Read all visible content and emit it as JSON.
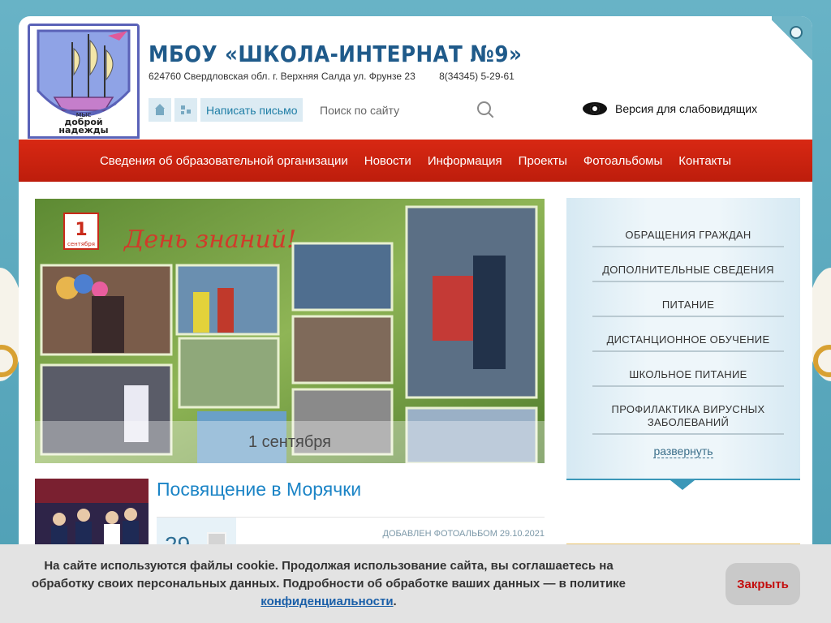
{
  "header": {
    "title": "МБОУ «ШКОЛА-ИНТЕРНАТ №9»",
    "address": "624760 Свердловская обл. г. Верхняя Салда ул. Фрунзе 23",
    "phone": "8(34345) 5-29-61",
    "logo_text_top": "мыс",
    "logo_text_mid": "доброй",
    "logo_text_bottom": "надежды"
  },
  "tools": {
    "home_icon": "home-icon",
    "sitemap_icon": "sitemap-icon",
    "write_label": "Написать письмо"
  },
  "search": {
    "placeholder": "Поиск по сайту",
    "icon": "search-icon"
  },
  "vision": {
    "label": "Версия для слабовидящих",
    "icon": "eye-icon"
  },
  "nav": {
    "items": [
      {
        "label": "Сведения об образовательной организации"
      },
      {
        "label": "Новости"
      },
      {
        "label": "Информация"
      },
      {
        "label": "Проекты"
      },
      {
        "label": "Фотоальбомы"
      },
      {
        "label": "Контакты"
      }
    ]
  },
  "slider": {
    "caption": "1 сентября",
    "banner_text": "День знаний!",
    "calendar_day": "1",
    "calendar_month": "сентября"
  },
  "news": {
    "title": "Посвящение в Морячки",
    "day": "29",
    "meta": "ДОБАВЛЕН ФОТОАЛЬБОМ 29.10.2021"
  },
  "panel": {
    "items": [
      {
        "label": "ОБРАЩЕНИЯ ГРАЖДАН"
      },
      {
        "label": "ДОПОЛНИТЕЛЬНЫЕ СВЕДЕНИЯ"
      },
      {
        "label": "ПИТАНИЕ"
      },
      {
        "label": "ДИСТАНЦИОННОЕ ОБУЧЕНИЕ"
      },
      {
        "label": "ШКОЛЬНОЕ ПИТАНИЕ"
      },
      {
        "label": "ПРОФИЛАКТИКА ВИРУСНЫХ ЗАБОЛЕВАНИЙ"
      }
    ],
    "expand_label": "развернуть"
  },
  "cookie": {
    "text": "На сайте используются файлы cookie. Продолжая использование сайта, вы соглашаетесь на обработку своих персональных данных. Подробности об обработке ваших данных — в политике",
    "link": "конфиденциальности",
    "close_label": "Закрыть"
  },
  "colors": {
    "nav_red": "#c9210f",
    "title_blue": "#1f5a8a",
    "link_blue": "#1b84c6",
    "panel_bg": "#eef6fa",
    "cookie_bg": "#e3e3e3"
  }
}
